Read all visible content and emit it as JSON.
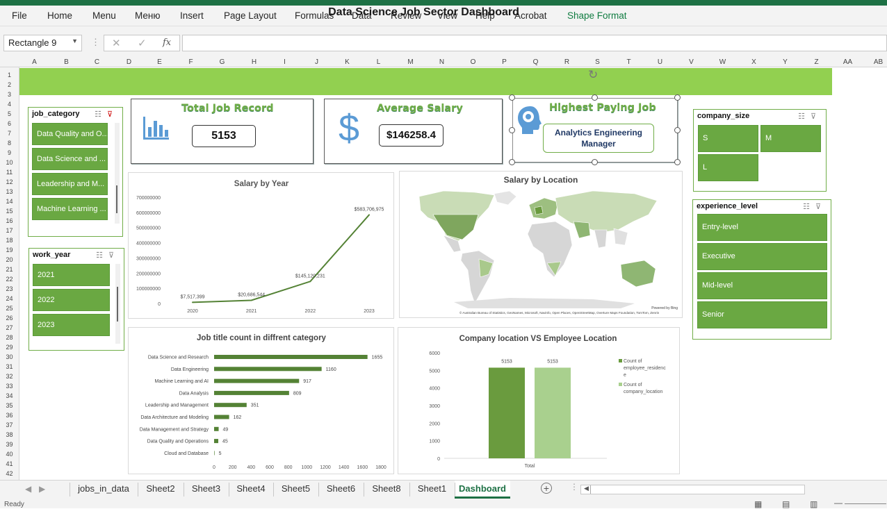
{
  "ribbon": {
    "tabs": [
      "File",
      "Home",
      "Menu",
      "Меню",
      "Insert",
      "Page Layout",
      "Formulas",
      "Data",
      "Review",
      "View",
      "Help",
      "Acrobat",
      "Shape Format"
    ]
  },
  "formula_bar": {
    "name_box": "Rectangle 9",
    "fx_label": "fx",
    "formula": ""
  },
  "columns": [
    "A",
    "B",
    "C",
    "D",
    "E",
    "F",
    "G",
    "H",
    "I",
    "J",
    "K",
    "L",
    "M",
    "N",
    "O",
    "P",
    "Q",
    "R",
    "S",
    "T",
    "U",
    "V",
    "W",
    "X",
    "Y",
    "Z",
    "AA",
    "AB"
  ],
  "rows": [
    "1",
    "2",
    "3",
    "4",
    "5",
    "6",
    "7",
    "8",
    "9",
    "10",
    "11",
    "12",
    "13",
    "14",
    "15",
    "16",
    "17",
    "18",
    "19",
    "20",
    "21",
    "22",
    "23",
    "24",
    "25",
    "26",
    "27",
    "28",
    "29",
    "30",
    "31",
    "32",
    "33",
    "34",
    "35",
    "36",
    "37",
    "38",
    "39",
    "40",
    "41",
    "42"
  ],
  "dashboard": {
    "title": "Data Science Job Sector Dashboard",
    "kpi_total": {
      "label": "Total Job Record",
      "value": "5153"
    },
    "kpi_salary": {
      "label": "Average Salary",
      "value": "$146258.4"
    },
    "kpi_job": {
      "label": "Highest Paying Job",
      "value": "Analytics Engineering Manager"
    }
  },
  "slicers": {
    "job_category": {
      "title": "job_category",
      "items": [
        "Data Quality and O...",
        "Data Science and ...",
        "Leadership and M...",
        "Machine Learning ..."
      ]
    },
    "work_year": {
      "title": "work_year",
      "items": [
        "2021",
        "2022",
        "2023"
      ]
    },
    "company_size": {
      "title": "company_size",
      "items": [
        "S",
        "M",
        "L"
      ]
    },
    "experience_level": {
      "title": "experience_level",
      "items": [
        "Entry-level",
        "Executive",
        "Mid-level",
        "Senior"
      ]
    }
  },
  "charts": {
    "salary_by_location": {
      "title": "Salary by Location",
      "attribution": "© Australian Bureau of Statistics, GeoNames, Microsoft, Navinfo, Open Places, OpenStreetMap, Overture Maps Foundation, TomTom, Zenrin",
      "powered": "Powered by Bing"
    }
  },
  "chart_data": [
    {
      "type": "line",
      "title": "Salary by Year",
      "x": [
        "2020",
        "2021",
        "2022",
        "2023"
      ],
      "values": [
        7517399,
        20686544,
        145120231,
        583706975
      ],
      "data_labels": [
        "$7,517,399",
        "$20,686,544",
        "$145,120,231",
        "$583,706,975"
      ],
      "ylim": [
        0,
        700000000
      ],
      "yticks": [
        "0",
        "100000000",
        "200000000",
        "300000000",
        "400000000",
        "500000000",
        "600000000",
        "700000000"
      ],
      "color": "#548235"
    },
    {
      "type": "bar",
      "orientation": "horizontal",
      "title": "Job title count in diffrent category",
      "categories": [
        "Data Science and Research",
        "Data Engineering",
        "Machine Learning and AI",
        "Data Analysis",
        "Leadership and Management",
        "Data Architecture and Modeling",
        "Data Management and Strategy",
        "Data Quality and Operations",
        "Cloud and Database"
      ],
      "values": [
        1655,
        1160,
        917,
        809,
        351,
        162,
        49,
        45,
        5
      ],
      "xlim": [
        0,
        1800
      ],
      "xticks": [
        "0",
        "200",
        "400",
        "600",
        "800",
        "1000",
        "1200",
        "1400",
        "1600",
        "1800"
      ],
      "color": "#548235"
    },
    {
      "type": "bar",
      "title": "Company location VS Employee Location",
      "categories": [
        "Total"
      ],
      "series": [
        {
          "name": "Count of employee_residence",
          "values": [
            5153
          ],
          "color": "#6a9b3e"
        },
        {
          "name": "Count of company_location",
          "values": [
            5153
          ],
          "color": "#a9d08e"
        }
      ],
      "ylim": [
        0,
        6000
      ],
      "yticks": [
        "0",
        "1000",
        "2000",
        "3000",
        "4000",
        "5000",
        "6000"
      ],
      "legend": "right"
    }
  ],
  "sheet_tabs": [
    "jobs_in_data",
    "Sheet2",
    "Sheet3",
    "Sheet4",
    "Sheet5",
    "Sheet6",
    "Sheet8",
    "Sheet1",
    "Dashboard"
  ],
  "active_sheet": "Dashboard",
  "status": {
    "text": "Ready"
  }
}
